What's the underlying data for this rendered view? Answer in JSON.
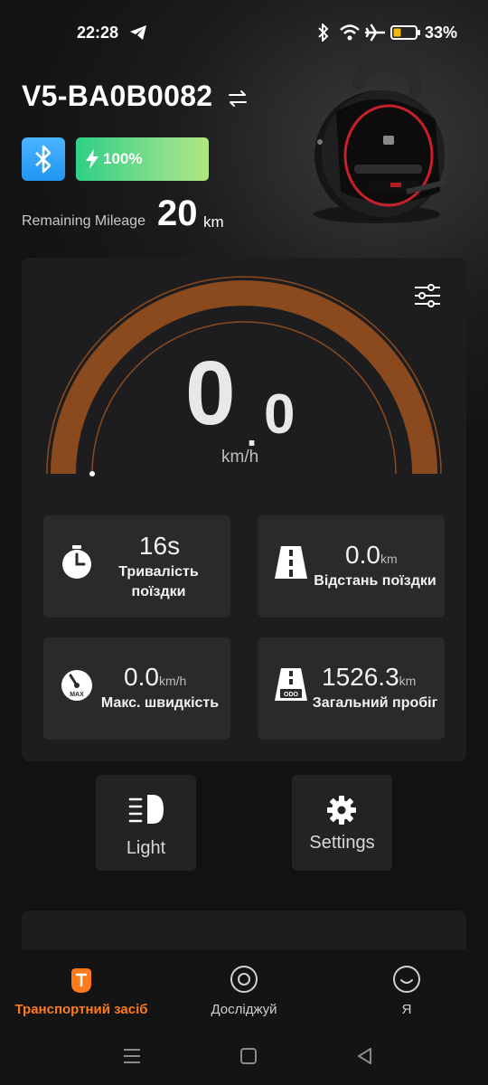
{
  "status_bar": {
    "time": "22:28",
    "battery_percent": "33%",
    "icons": [
      "telegram-icon",
      "bluetooth-icon",
      "wifi-icon",
      "airplane-icon",
      "battery-icon"
    ]
  },
  "device": {
    "name": "V5-BA0B0082",
    "battery_level": "100%",
    "remaining_mileage_label": "Remaining Mileage",
    "remaining_mileage_value": "20",
    "remaining_mileage_unit": "km"
  },
  "speedometer": {
    "speed_integer": "0",
    "speed_decimal": "0",
    "unit": "km/h",
    "progress": 0
  },
  "stats": [
    {
      "value": "16s",
      "unit": "",
      "label_line1": "Тривалість",
      "label_line2": "поїздки"
    },
    {
      "value": "0.0",
      "unit": "km",
      "label_line1": "Відстань поїздки",
      "label_line2": ""
    },
    {
      "value": "0.0",
      "unit": "km/h",
      "label_line1": "Макс. швидкість",
      "label_line2": ""
    },
    {
      "value": "1526.3",
      "unit": "km",
      "label_line1": "Загальний пробіг",
      "label_line2": ""
    }
  ],
  "icon_text": {
    "max": "MAX",
    "odo": "ODO"
  },
  "actions": {
    "light_label": "Light",
    "settings_label": "Settings"
  },
  "nav": {
    "vehicle": "Транспортний засіб",
    "explore": "Досліджуй",
    "me": "Я"
  },
  "colors": {
    "accent": "#ff7a1a",
    "gauge_fill": "#8b4a1d",
    "bluetooth": "#2196f3",
    "battery_green": "#2ecf87"
  }
}
